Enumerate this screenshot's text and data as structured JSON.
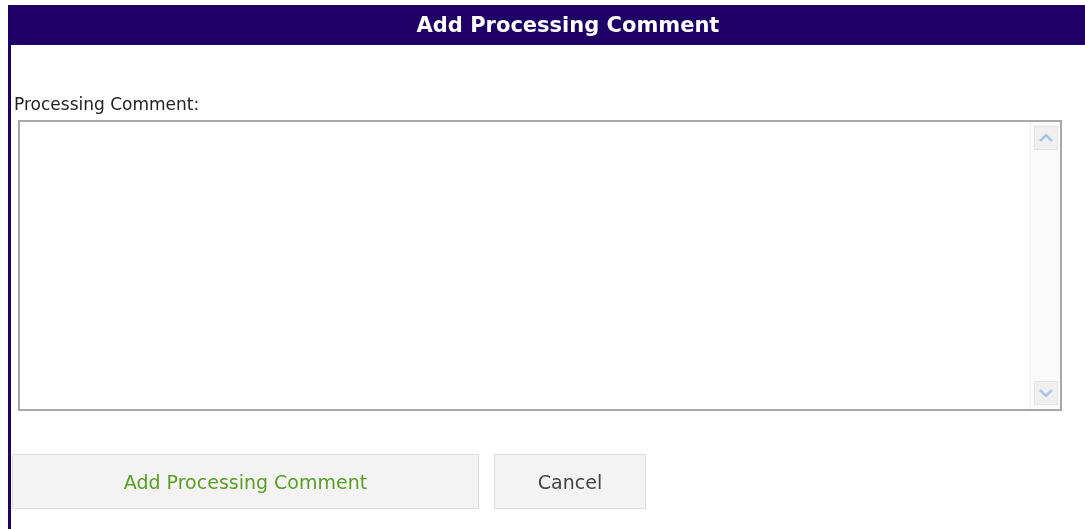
{
  "dialog": {
    "title": "Add Processing Comment"
  },
  "comment_field": {
    "label": "Processing Comment:"
  },
  "buttons": [
    {
      "label": "Add Processing Comment",
      "kind": "primary"
    },
    {
      "label": "Cancel",
      "kind": "secondary"
    }
  ]
}
